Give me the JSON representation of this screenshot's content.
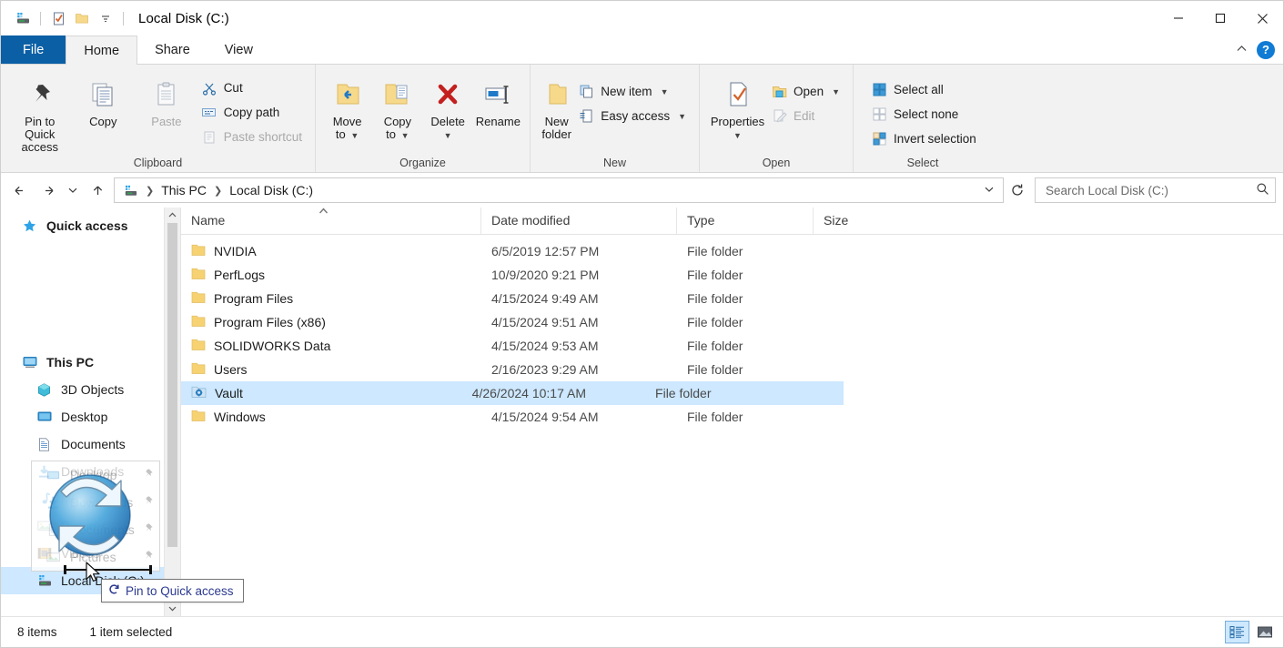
{
  "window": {
    "title": "Local Disk (C:)",
    "qat_icons": [
      "drive-icon",
      "properties-check-icon",
      "new-folder-icon",
      "customize-qat-caret-icon"
    ],
    "controls": {
      "minimize": "minimize-icon",
      "maximize": "maximize-icon",
      "close": "close-icon"
    }
  },
  "tabs": [
    {
      "id": "file",
      "label": "File"
    },
    {
      "id": "home",
      "label": "Home"
    },
    {
      "id": "share",
      "label": "Share"
    },
    {
      "id": "view",
      "label": "View"
    }
  ],
  "tab_right": {
    "collapse": "collapse-ribbon-icon",
    "help": "?"
  },
  "ribbon": {
    "groups": [
      {
        "title": "Clipboard",
        "big": [
          {
            "label": "Pin to Quick\naccess",
            "icon": "pin-icon",
            "disabled": false
          },
          {
            "label": "Copy",
            "icon": "copy-icon",
            "disabled": false
          },
          {
            "label": "Paste",
            "icon": "paste-icon",
            "disabled": true
          }
        ],
        "small": [
          {
            "label": "Cut",
            "icon": "scissors-icon",
            "disabled": false
          },
          {
            "label": "Copy path",
            "icon": "copy-path-icon",
            "disabled": false
          },
          {
            "label": "Paste shortcut",
            "icon": "paste-shortcut-icon",
            "disabled": true
          }
        ]
      },
      {
        "title": "Organize",
        "big": [
          {
            "label": "Move\nto",
            "icon": "move-to-icon",
            "caret": true
          },
          {
            "label": "Copy\nto",
            "icon": "copy-to-icon",
            "caret": true
          },
          {
            "label": "Delete",
            "icon": "delete-x-icon",
            "caret": true
          },
          {
            "label": "Rename",
            "icon": "rename-icon",
            "caret": false
          }
        ]
      },
      {
        "title": "New",
        "big": [
          {
            "label": "New\nfolder",
            "icon": "new-folder-icon",
            "caret": false
          }
        ],
        "small": [
          {
            "label": "New item",
            "icon": "new-item-icon",
            "caret": true
          },
          {
            "label": "Easy access",
            "icon": "easy-access-icon",
            "caret": true
          }
        ]
      },
      {
        "title": "Open",
        "big": [
          {
            "label": "Properties",
            "icon": "properties-icon",
            "caret": true
          }
        ],
        "small": [
          {
            "label": "Open",
            "icon": "open-icon",
            "caret": true,
            "disabled": false
          },
          {
            "label": "Edit",
            "icon": "edit-icon",
            "caret": false,
            "disabled": true
          }
        ]
      },
      {
        "title": "Select",
        "small": [
          {
            "label": "Select all",
            "icon": "select-all-icon"
          },
          {
            "label": "Select none",
            "icon": "select-none-icon"
          },
          {
            "label": "Invert selection",
            "icon": "invert-selection-icon"
          }
        ]
      }
    ]
  },
  "address": {
    "back": "back-arrow-icon",
    "forward": "forward-arrow-icon",
    "recent": "recent-locations-caret-icon",
    "up": "up-arrow-icon",
    "crumb_icon": "drive-icon",
    "crumbs": [
      "This PC",
      "Local Disk (C:)"
    ],
    "dropdown": "address-dropdown-caret-icon",
    "refresh": "refresh-icon"
  },
  "search": {
    "placeholder": "Search Local Disk (C:)",
    "value": "",
    "icon": "search-icon"
  },
  "navpane": {
    "items": [
      {
        "label": "Quick access",
        "icon": "star-icon",
        "indent": false,
        "selected": false
      },
      {
        "label": "This PC",
        "icon": "this-pc-icon",
        "indent": false,
        "selected": false
      },
      {
        "label": "3D Objects",
        "icon": "3d-objects-icon",
        "indent": true,
        "selected": false
      },
      {
        "label": "Desktop",
        "icon": "desktop-icon",
        "indent": true,
        "selected": false
      },
      {
        "label": "Documents",
        "icon": "documents-icon",
        "indent": true,
        "selected": false
      },
      {
        "label": "Downloads",
        "icon": "downloads-icon",
        "indent": true,
        "selected": false
      },
      {
        "label": "Music",
        "icon": "music-icon",
        "indent": true,
        "selected": false
      },
      {
        "label": "Pictures",
        "icon": "pictures-icon",
        "indent": true,
        "selected": false
      },
      {
        "label": "Videos",
        "icon": "videos-icon",
        "indent": true,
        "selected": false
      },
      {
        "label": "Local Disk (C:)",
        "icon": "drive-icon",
        "indent": true,
        "selected": true
      }
    ],
    "scroll_up": "scroll-up-icon",
    "scroll_down": "scroll-down-icon"
  },
  "drag": {
    "items": [
      {
        "label": "Desktop",
        "icon": "desktop-icon"
      },
      {
        "label": "Downloads",
        "icon": "downloads-icon"
      },
      {
        "label": "Documents",
        "icon": "documents-icon"
      },
      {
        "label": "Pictures",
        "icon": "pictures-icon"
      }
    ],
    "badge": "sync-refresh-icon",
    "tooltip_label": "Pin to Quick access",
    "tooltip_icon": "pin-to-quick-access-icon"
  },
  "filelist": {
    "columns": [
      {
        "key": "name",
        "label": "Name"
      },
      {
        "key": "date",
        "label": "Date modified"
      },
      {
        "key": "type",
        "label": "Type"
      },
      {
        "key": "size",
        "label": "Size"
      }
    ],
    "sort_indicator": "ascending-caret-icon",
    "rows": [
      {
        "name": "NVIDIA",
        "date": "6/5/2019 12:57 PM",
        "type": "File folder",
        "size": "",
        "icon": "folder-icon",
        "selected": false
      },
      {
        "name": "PerfLogs",
        "date": "10/9/2020 9:21 PM",
        "type": "File folder",
        "size": "",
        "icon": "folder-icon",
        "selected": false
      },
      {
        "name": "Program Files",
        "date": "4/15/2024 9:49 AM",
        "type": "File folder",
        "size": "",
        "icon": "folder-icon",
        "selected": false
      },
      {
        "name": "Program Files (x86)",
        "date": "4/15/2024 9:51 AM",
        "type": "File folder",
        "size": "",
        "icon": "folder-icon",
        "selected": false
      },
      {
        "name": "SOLIDWORKS Data",
        "date": "4/15/2024 9:53 AM",
        "type": "File folder",
        "size": "",
        "icon": "folder-icon",
        "selected": false
      },
      {
        "name": "Users",
        "date": "2/16/2023 9:29 AM",
        "type": "File folder",
        "size": "",
        "icon": "folder-icon",
        "selected": false
      },
      {
        "name": "Vault",
        "date": "4/26/2024 10:17 AM",
        "type": "File folder",
        "size": "",
        "icon": "vault-folder-icon",
        "selected": true
      },
      {
        "name": "Windows",
        "date": "4/15/2024 9:54 AM",
        "type": "File folder",
        "size": "",
        "icon": "folder-icon",
        "selected": false
      }
    ]
  },
  "statusbar": {
    "item_count": "8 items",
    "selection": "1 item selected",
    "details_view": "details-view-icon",
    "large_icons_view": "large-icons-view-icon"
  },
  "colors": {
    "accent_blue": "#0b5fa5",
    "selection_blue": "#cde8ff",
    "folder_yellow": "#f7d272",
    "help_blue": "#0f7bd4"
  }
}
